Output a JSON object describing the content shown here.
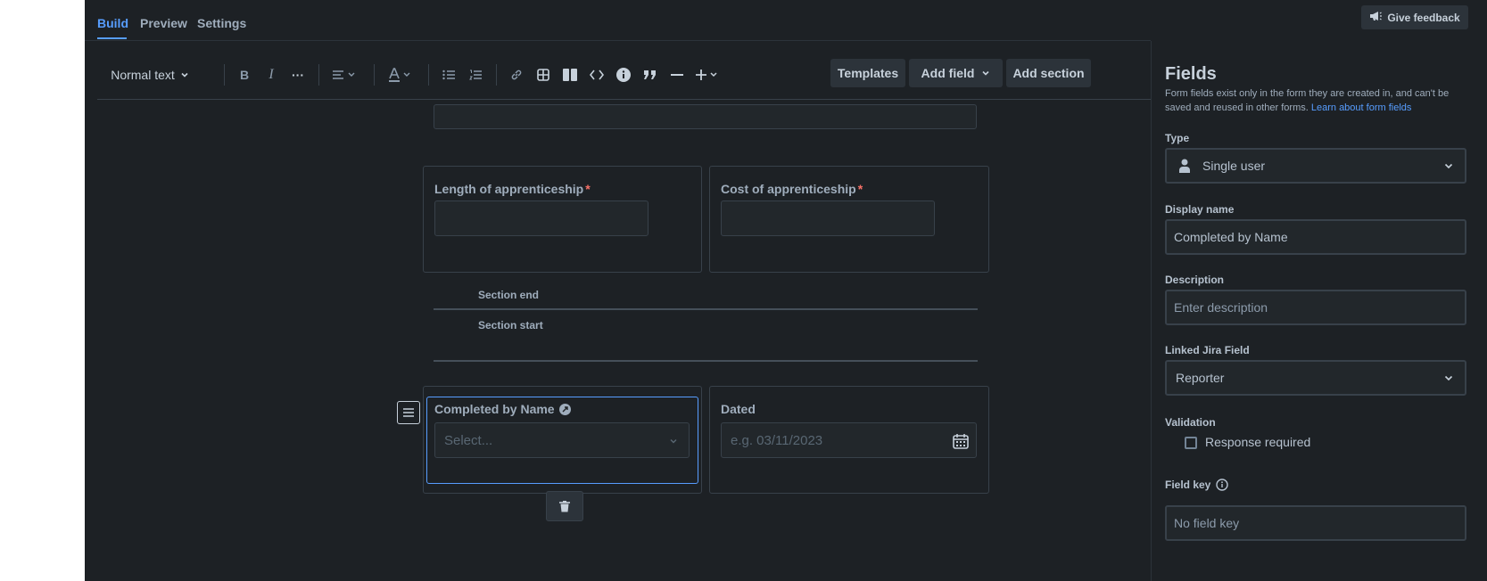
{
  "tabs": [
    {
      "label": "Build",
      "active": true
    },
    {
      "label": "Preview",
      "active": false
    },
    {
      "label": "Settings",
      "active": false
    }
  ],
  "feedback": {
    "label": "Give feedback",
    "icon": "megaphone-icon"
  },
  "toolbar": {
    "text_style": "Normal text",
    "templates": "Templates",
    "add_field": "Add field",
    "add_section": "Add section"
  },
  "form": {
    "length_label": "Length of apprenticeship",
    "cost_label": "Cost of apprenticeship",
    "required_mark": "*",
    "section_end": "Section end",
    "section_start": "Section start",
    "completed_label": "Completed by Name",
    "completed_placeholder": "Select...",
    "dated_label": "Dated",
    "dated_placeholder": "e.g. 03/11/2023"
  },
  "panel": {
    "title": "Fields",
    "description": "Form fields exist only in the form they are created in, and can't be saved and reused in other forms.",
    "learn_link": "Learn about form fields",
    "type_label": "Type",
    "type_value": "Single user",
    "display_name_label": "Display name",
    "display_name_value": "Completed by Name",
    "description_label": "Description",
    "description_placeholder": "Enter description",
    "linked_label": "Linked Jira Field",
    "linked_value": "Reporter",
    "validation_label": "Validation",
    "response_required": "Response required",
    "field_key_label": "Field key",
    "field_key_placeholder": "No field key"
  },
  "colors": {
    "background": "#1d2125",
    "accent": "#579dff",
    "required": "#f87168",
    "selected_border": "#579dff"
  }
}
